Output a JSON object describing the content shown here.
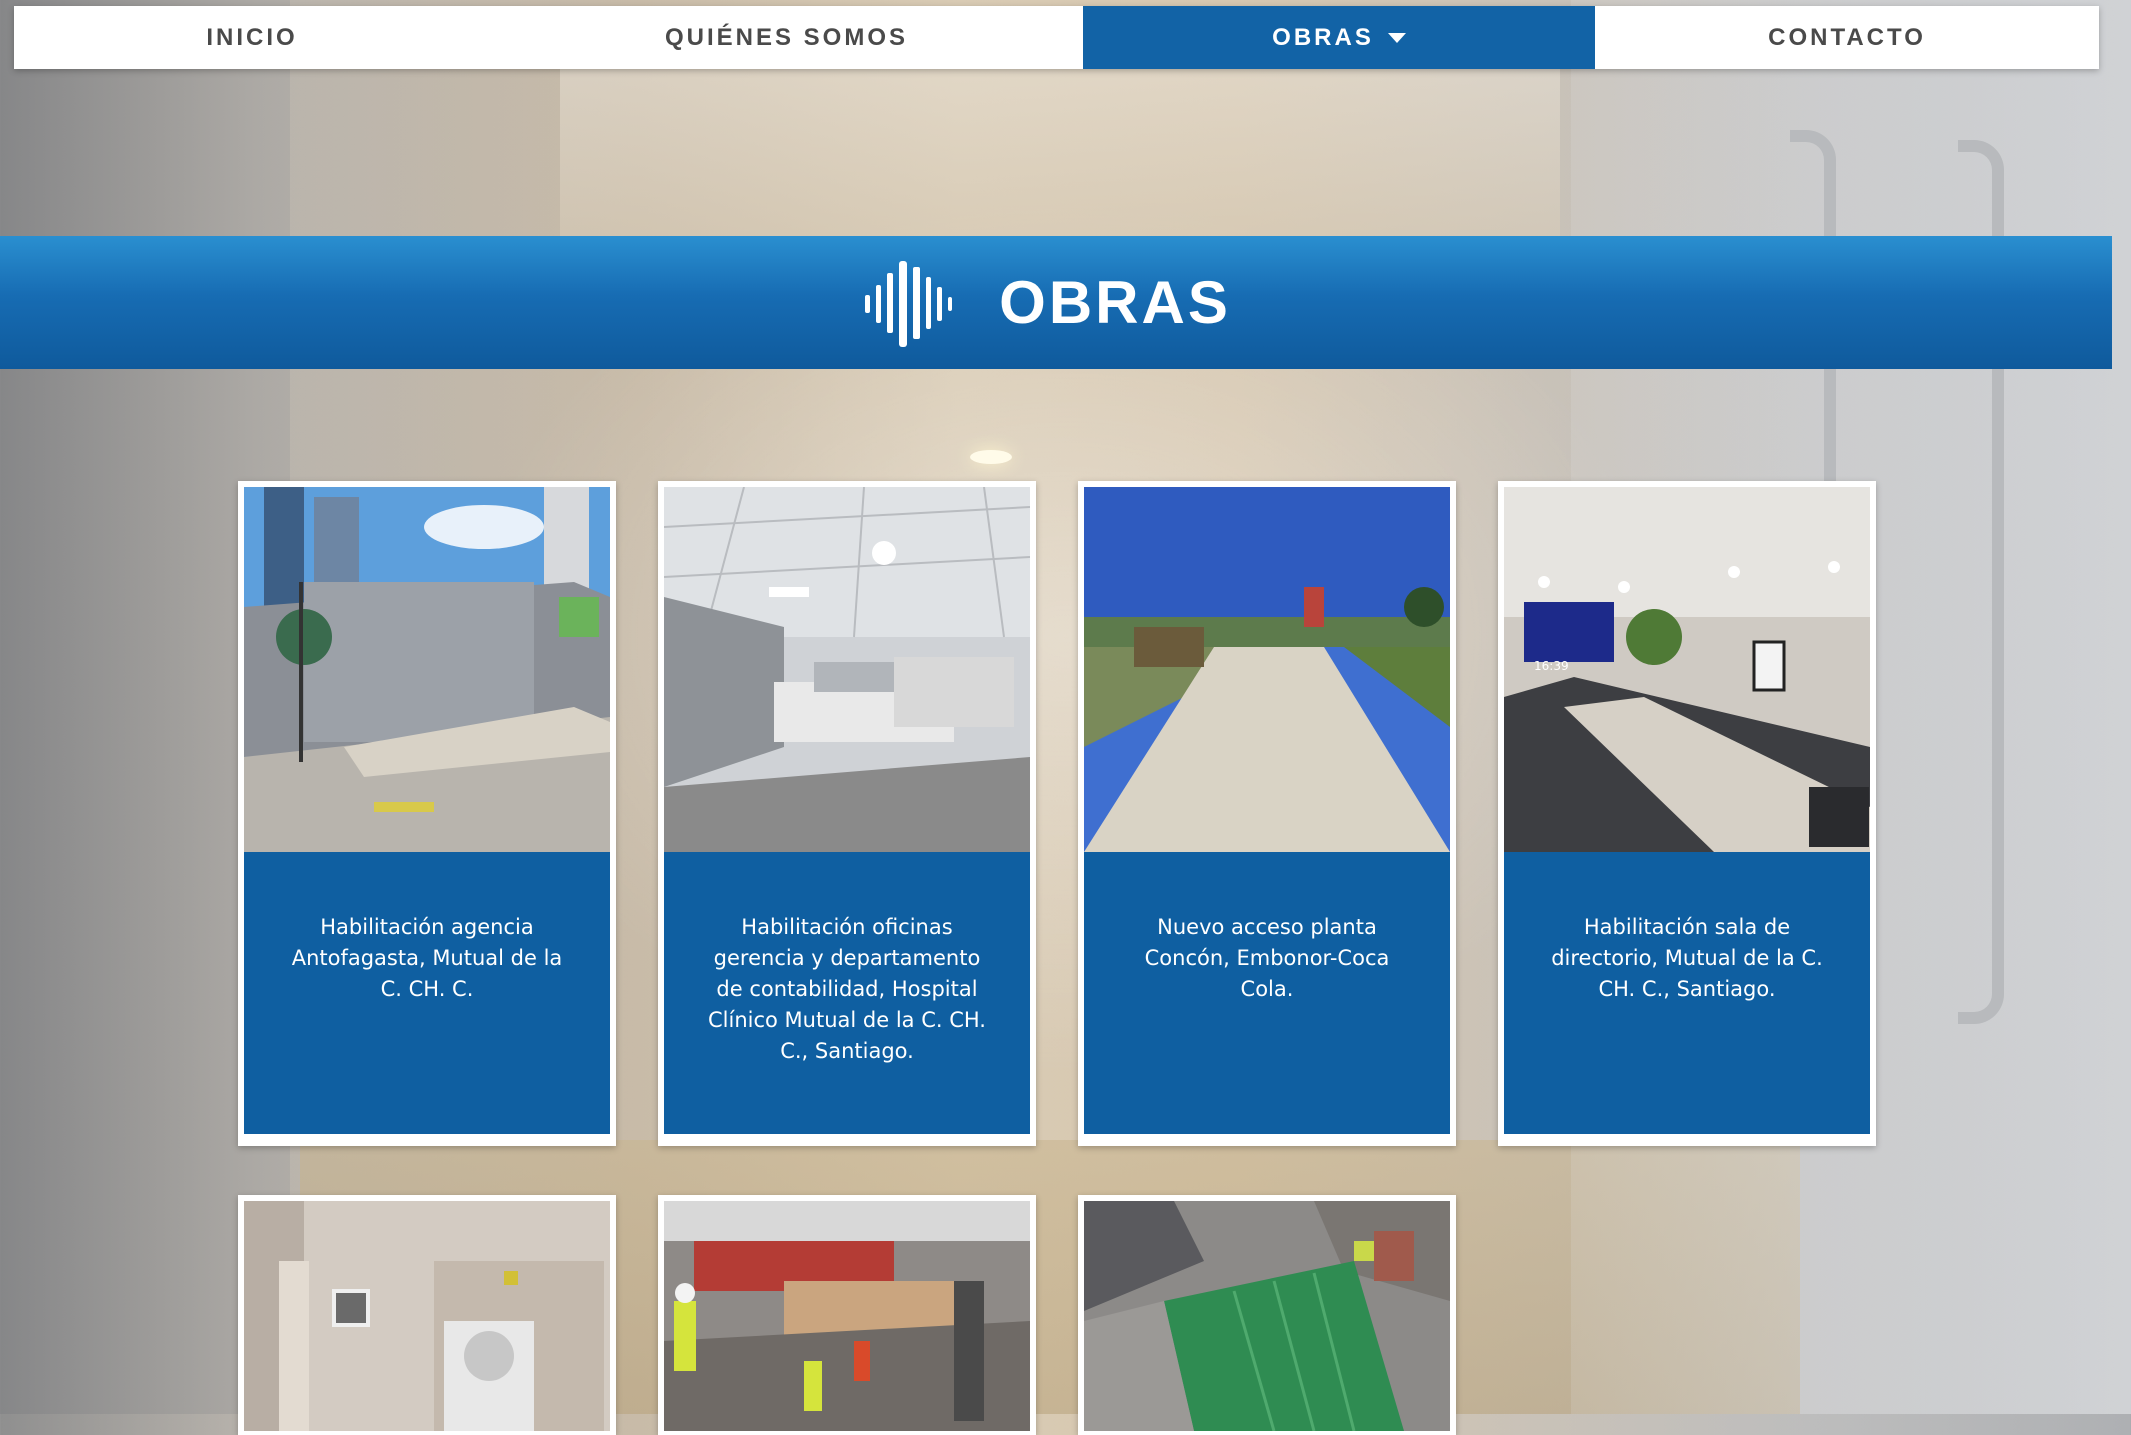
{
  "nav": {
    "items": [
      {
        "label": "INICIO"
      },
      {
        "label": "QUIÉNES SOMOS"
      },
      {
        "label": "OBRAS"
      },
      {
        "label": "CONTACTO"
      }
    ]
  },
  "banner": {
    "title": "OBRAS",
    "icon": "sound-bars-logo-icon"
  },
  "projects": [
    {
      "caption": "Habilitación agencia Antofagasta, Mutual de la C. CH. C."
    },
    {
      "caption": "Habilitación oficinas gerencia y departamento de contabilidad, Hospital Clínico Mutual de la C. CH. C., Santiago."
    },
    {
      "caption": "Nuevo acceso planta Concón, Embonor-Coca Cola."
    },
    {
      "caption": "Habilitación sala de directorio, Mutual de la C. CH. C., Santiago."
    },
    {
      "caption": ""
    },
    {
      "caption": ""
    },
    {
      "caption": ""
    }
  ],
  "photos": {
    "conference_screen_text": "16:39"
  },
  "colors": {
    "primary": "#1263a6",
    "banner_light": "#2a8fd0",
    "card_caption": "#0f5fa1"
  }
}
